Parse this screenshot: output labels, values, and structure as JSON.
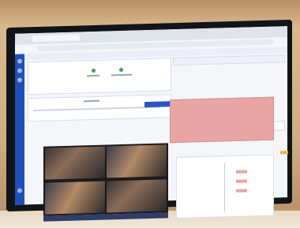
{
  "scene": {
    "description_free": true,
    "colors": {
      "accent": "#2a54c9",
      "status_ok": "#3aa657",
      "alert_fill": "#e9a4a4",
      "warning": "#f2b233"
    }
  }
}
